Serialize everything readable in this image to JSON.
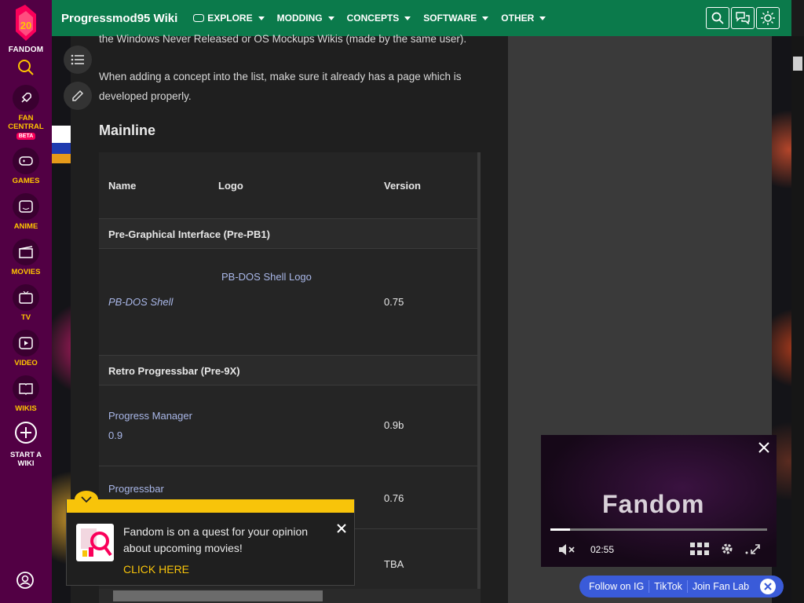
{
  "rail": {
    "logo_number": "20",
    "logo_label": "FANDOM",
    "items": [
      {
        "label": "FAN CENTRAL",
        "badge": "BETA",
        "icon": "rocket-icon"
      },
      {
        "label": "GAMES",
        "icon": "gamepad-icon"
      },
      {
        "label": "ANIME",
        "icon": "anime-face-icon"
      },
      {
        "label": "MOVIES",
        "icon": "clapperboard-icon"
      },
      {
        "label": "TV",
        "icon": "tv-icon"
      },
      {
        "label": "VIDEO",
        "icon": "play-icon"
      },
      {
        "label": "WIKIS",
        "icon": "book-icon"
      },
      {
        "label": "START A WIKI",
        "icon": "plus-circle-icon"
      }
    ]
  },
  "topnav": {
    "wiki_title": "Progressmod95 Wiki",
    "items": [
      "EXPLORE",
      "MODDING",
      "CONCEPTS",
      "SOFTWARE",
      "OTHER"
    ]
  },
  "content": {
    "intro_line": "the Windows Never Released or OS Mockups Wikis (made by the same user).",
    "para2_line1": "When adding a concept into the list, make sure it already has a page which is",
    "para2_line2": "developed properly.",
    "heading": "Mainline",
    "table": {
      "headers": [
        "Name",
        "Logo",
        "Version"
      ],
      "group1": "Pre-Graphical Interface (Pre-PB1)",
      "row1": {
        "name": "PB-DOS Shell",
        "logo": "PB-DOS Shell Logo",
        "version": "0.75"
      },
      "group2": "Retro Progressbar (Pre-9X)",
      "row2": {
        "name_line1": "Progress Manager",
        "name_line2": "0.9",
        "version": "0.9b"
      },
      "row3": {
        "name": "Progressbar",
        "version": "0.76"
      },
      "row4": {
        "version": "TBA"
      }
    }
  },
  "notification": {
    "text": "Fandom is on a quest for your opinion about upcoming movies!",
    "cta": "CLICK HERE"
  },
  "video": {
    "logo": "Fandom",
    "time": "02:55",
    "progress": 0.09
  },
  "social": {
    "items": [
      "Follow on IG",
      "TikTok",
      "Join Fan Lab"
    ]
  },
  "colors": {
    "rail_bg": "#520044",
    "nav_bg": "#0b7a4b",
    "accent_yellow": "#ffc500",
    "link": "#a9b7e8",
    "social_bg": "#3a5bd9"
  }
}
